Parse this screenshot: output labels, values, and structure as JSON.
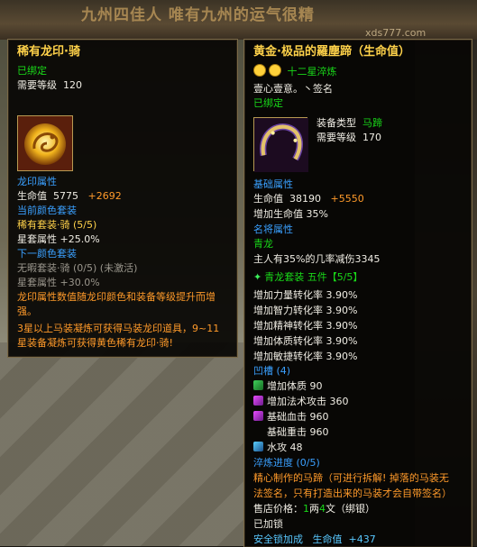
{
  "background": {
    "banner_text": "九州四佳人    唯有九州的运气很精",
    "watermark": "xds777.com"
  },
  "tooltip_left": {
    "title": "稀有龙印·骑",
    "bound": "已绑定",
    "req_level_label": "需要等级",
    "req_level": "120",
    "icon": "dragon-seal-icon",
    "section_dragon_attr": "龙印属性",
    "hp_label": "生命值",
    "hp_value": "5775",
    "hp_bonus": "+2692",
    "section_current_color": "当前颜色套装",
    "current_set": "稀有套装·骑  (5/5)",
    "set_attr_label": "星套属性",
    "set_attr_value": "+25.0%",
    "section_next_color": "下一颜色套装",
    "next_set": "无暇套装·骑  (0/5)  (未激活)",
    "next_set_attr_label": "星套属性",
    "next_set_attr_value": "+30.0%",
    "desc1a": "龙印属性数值随龙印颜色和装备等级提升而增",
    "desc1b": "强。",
    "desc2a": "3星以上马装凝炼可获得马装龙印道具，9~11",
    "desc2b": "星装备凝炼可获得黄色稀有龙印·骑!"
  },
  "tooltip_right": {
    "title": "黄金·极品的羅塵蹄（生命值）",
    "refine_label": "十二星淬炼",
    "owner": "壹心壹意。丶签名",
    "bound": "已绑定",
    "icon": "horseshoe-icon",
    "equip_type_label": "装备类型",
    "equip_type": "马蹄",
    "req_level_label": "需要等级",
    "req_level": "170",
    "section_base": "基础属性",
    "hp_label": "生命值",
    "hp_value": "38190",
    "hp_bonus": "+5550",
    "hp_pct": "增加生命值  35%",
    "section_name": "名将属性",
    "name_attr": "青龙",
    "name_attr_desc": "主人有35%的几率减伤3345",
    "set_name": "青龙套装  五件【5/5】",
    "set_lines": [
      "增加力量转化率  3.90%",
      "增加智力转化率  3.90%",
      "增加精神转化率  3.90%",
      "增加体质转化率  3.90%",
      "增加敏捷转化率  3.90%"
    ],
    "slots_label": "凹槽  (4)",
    "gems": [
      {
        "icon": "green-gem-icon",
        "text": "增加体质  90"
      },
      {
        "icon": "purple-gem-icon",
        "text": "增加法术攻击  360"
      },
      {
        "icon": "purple-gem-icon",
        "text": "基础血击  960"
      },
      {
        "icon": "",
        "text": "基础重击  960"
      },
      {
        "icon": "blue-gem-icon",
        "text": "水攻  48"
      }
    ],
    "refine_progress": "淬炼进度  (0/5)",
    "desc_a": "精心制作的马蹄（可进行拆解! 掉落的马装无",
    "desc_b": "法签名，只有打造出来的马装才会自带签名）",
    "price_label": "售店价格：",
    "price_liang": "1",
    "price_unit1": "两",
    "price_wen": "4",
    "price_unit2": "文",
    "price_bind": "（绑银）",
    "locked": "已加锁",
    "safety_label": "安全锁加成",
    "safety_stat": "生命值",
    "safety_value": "+437"
  }
}
